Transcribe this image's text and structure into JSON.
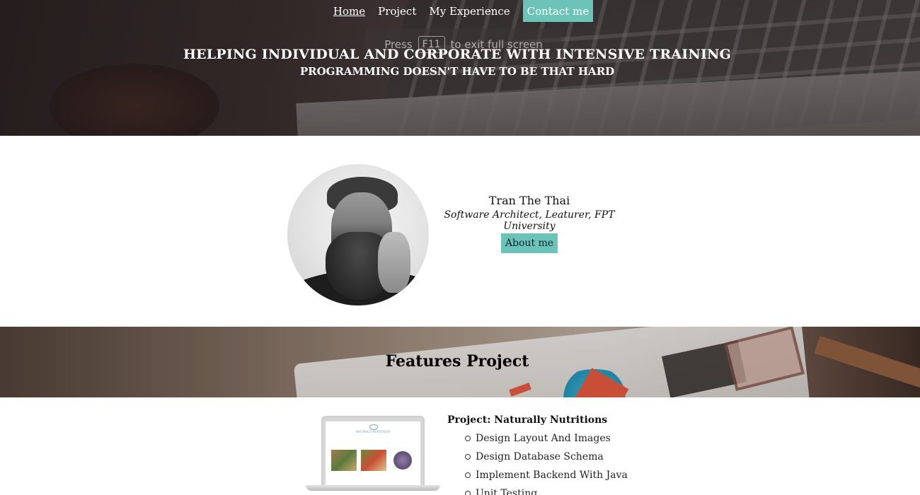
{
  "nav": {
    "items": [
      {
        "label": "Home",
        "active": true
      },
      {
        "label": "Project",
        "active": false
      },
      {
        "label": "My Experience",
        "active": false
      }
    ],
    "contact_label": "Contact me"
  },
  "fullscreen_hint": {
    "press": "Press",
    "key": "F11",
    "message": "to exit full screen"
  },
  "hero": {
    "headline": "HELPING INDIVIDUAL AND CORPORATE WITH INTENSIVE TRAINING",
    "subheadline": "PROGRAMMING DOESN'T HAVE TO BE THAT HARD"
  },
  "profile": {
    "name": "Tran The Thai",
    "role": "Software Architect, Leaturer, FPT University",
    "about_label": "About me"
  },
  "features": {
    "title": "Features Project"
  },
  "project": {
    "title": "Project: Naturally Nutritions",
    "thumb_logo": "NATURALLY NUTRITIOUS",
    "items": [
      "Design Layout And Images",
      "Design Database Schema",
      "Implement Backend With Java",
      "Unit Testing"
    ]
  },
  "colors": {
    "accent": "#6cc3b7"
  }
}
